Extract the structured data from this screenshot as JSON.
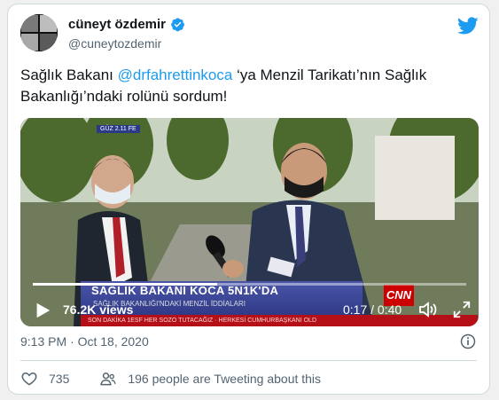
{
  "tweet": {
    "author_name": "cüneyt özdemir",
    "handle": "@cuneytozdemir",
    "text_before": "Sağlık Bakanı ",
    "mention": "@drfahrettinkoca",
    "text_after": " ‘ya Menzil Tarikatı’nın Sağlık Bakanlığı’ndaki rolünü sordum!",
    "timestamp": "9:13 PM · Oct 18, 2020",
    "likes": "735",
    "retweet_text": "196 people are Tweeting about this"
  },
  "video": {
    "views": "76.2K views",
    "time": "0:17 / 0:40",
    "progress": 0.425,
    "banner_line1": "SAĞLIK BAKANI KOCA 5N1K'DA",
    "banner_line2": "SAĞLIK BAKANLIĞI'NDAKİ MENZİL İDDİALARI",
    "ticker": "SON DAKİKA 1ESF HER SOZO TUTACAĞIZ · HERKESİ CUMHURBAŞKANI OLD",
    "channel": "CNN",
    "chyron_small": "GÜZ 2.11 FE"
  },
  "colors": {
    "accent": "#1d9bf0",
    "muted": "#536471",
    "text": "#0f1419"
  },
  "icons": [
    "verified-icon",
    "twitter-bird-icon",
    "play-icon",
    "volume-icon",
    "fullscreen-icon",
    "info-icon",
    "heart-icon",
    "people-icon"
  ]
}
